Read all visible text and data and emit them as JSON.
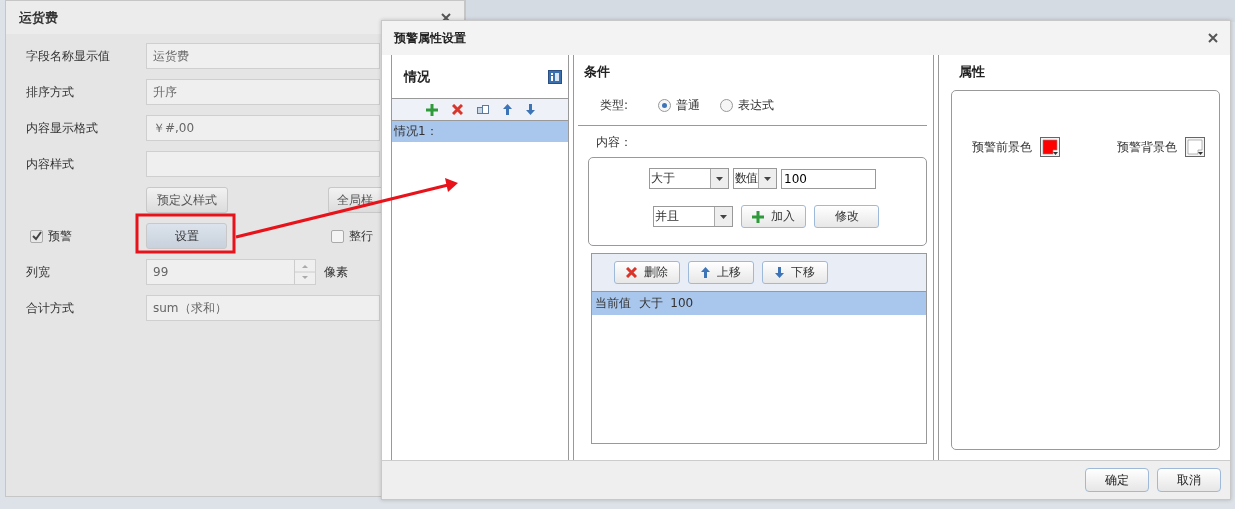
{
  "field_dialog": {
    "title": "运货费",
    "fields": [
      {
        "label": "字段名称显示值",
        "value": "运货费"
      },
      {
        "label": "排序方式",
        "value": "升序"
      },
      {
        "label": "内容显示格式",
        "value": "￥#,00"
      },
      {
        "label": "内容样式"
      }
    ],
    "style_buttons": [
      "预定义样式",
      "全局样"
    ],
    "warning": {
      "label": "预警",
      "checked": true
    },
    "settings_button": "设置",
    "whole_row": {
      "label": "整行",
      "checked": false
    },
    "column_width": {
      "label": "列宽",
      "value": "99",
      "unit": "像素"
    },
    "total": {
      "label": "合计方式",
      "value": "sum（求和）"
    }
  },
  "warning_dialog": {
    "title": "预警属性设置",
    "cases": {
      "title": "情况",
      "items": [
        {
          "label": "情况1：",
          "selected": true
        }
      ]
    },
    "condition": {
      "title": "条件",
      "type_label": "类型:",
      "types": [
        {
          "label": "普通",
          "selected": true
        },
        {
          "label": "表达式",
          "selected": false
        }
      ],
      "content_label": "内容：",
      "operator": "大于",
      "value_type": "数值",
      "value": "100",
      "conjunction": "并且",
      "add_button": "加入",
      "modify_button": "修改",
      "list_buttons": [
        {
          "kind": "delete",
          "label": "删除"
        },
        {
          "kind": "up",
          "label": "上移"
        },
        {
          "kind": "down",
          "label": "下移"
        }
      ],
      "rows": [
        {
          "label": "当前值  大于  100",
          "selected": true
        }
      ]
    },
    "properties": {
      "title": "属性",
      "colors": [
        {
          "label": "预警前景色",
          "color": "#ff0000"
        },
        {
          "label": "预警背景色",
          "color": "#ffffff"
        }
      ]
    },
    "buttons": [
      "确定",
      "取消"
    ]
  }
}
